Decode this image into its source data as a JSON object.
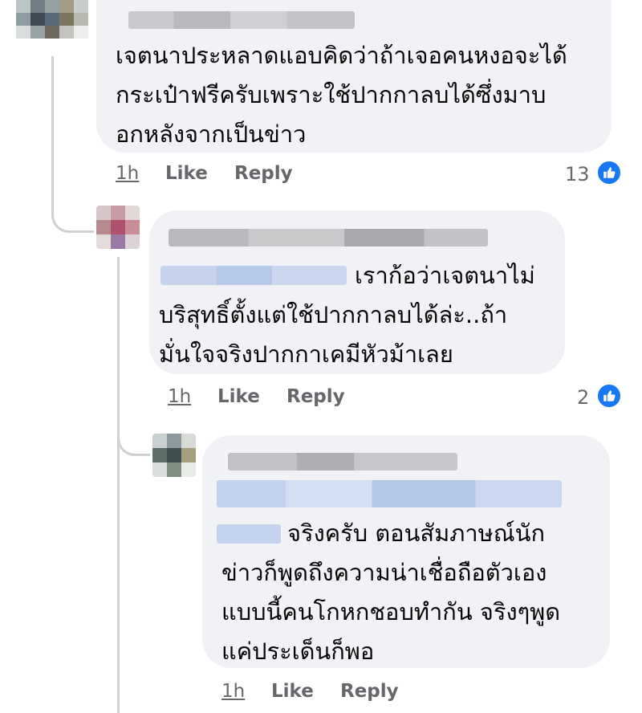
{
  "comments": [
    {
      "text": "เจตนาประหลาดแอบคิดว่าถ้าเจอคนหงอจะได้\nกระเป๋าฟรีครับเพราะใช้ปากกาลบได้ซึ่งมาบ\nอกหลังจากเป็นข่าว",
      "time": "1h",
      "like": "Like",
      "reply": "Reply",
      "reactions": "13",
      "reaction_icon": "thumbs-up-icon"
    },
    {
      "text": "เราก้อว่าเจตนาไม่\nบริสุทธิ์ตั้งแต่ใช้ปากกาลบได้ล่ะ..ถ้า\nมั่นใจจริงปากกาเคมีหัวม้าเลย",
      "time": "1h",
      "like": "Like",
      "reply": "Reply",
      "reactions": "2",
      "reaction_icon": "thumbs-up-icon"
    },
    {
      "text": "จริงครับ ตอนสัมภาษณ์นัก\nข่าวก็พูดถึงความน่าเชื่อถือตัวเอง\nแบบนี้คนโกหกชอบทำกัน จริงๆพูด\nแค่ประเด็นก็พอ",
      "time": "1h",
      "like": "Like",
      "reply": "Reply"
    }
  ],
  "colors": {
    "bubble": "#f0f2f5",
    "action_text": "#65676b",
    "like_blue": "#1877f2",
    "thread_line": "#ced0d4"
  }
}
